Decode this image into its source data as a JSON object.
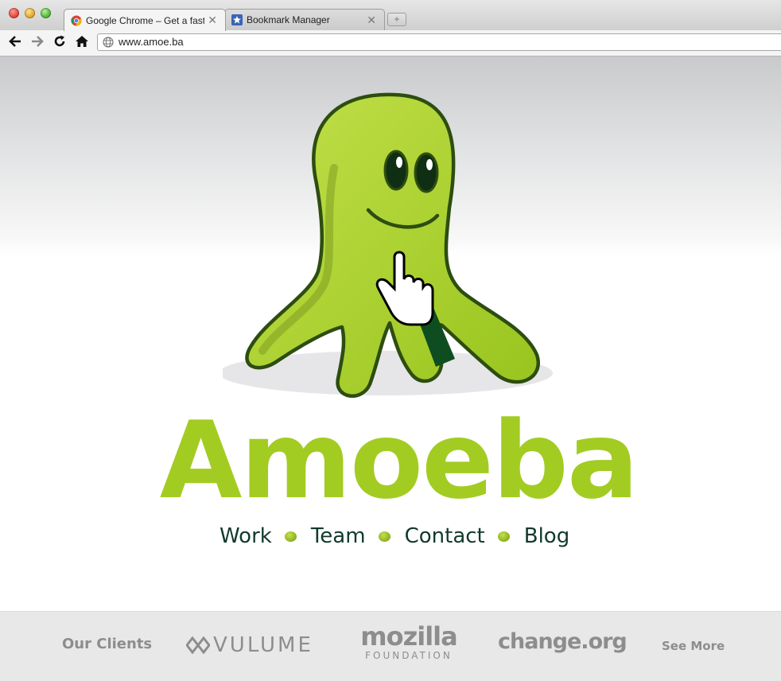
{
  "browser": {
    "tabs": [
      {
        "label": "Google Chrome – Get a fast new browser",
        "active": true,
        "icon": "chrome-icon"
      },
      {
        "label": "Bookmark Manager",
        "active": false,
        "icon": "star-icon"
      }
    ],
    "url": "www.amoe.ba"
  },
  "site": {
    "brand": "Amoeba",
    "nav": [
      "Work",
      "Team",
      "Contact",
      "Blog"
    ],
    "clients": {
      "label": "Our Clients",
      "logos": {
        "vulume": "VULUME",
        "mozilla": "mozilla",
        "mozilla_sub": "FOUNDATION",
        "change": "change.org"
      },
      "see_more": "See More"
    }
  },
  "colors": {
    "accent": "#a3cc22",
    "nav_text": "#113a2a",
    "clients_text": "#8d8d8d"
  }
}
